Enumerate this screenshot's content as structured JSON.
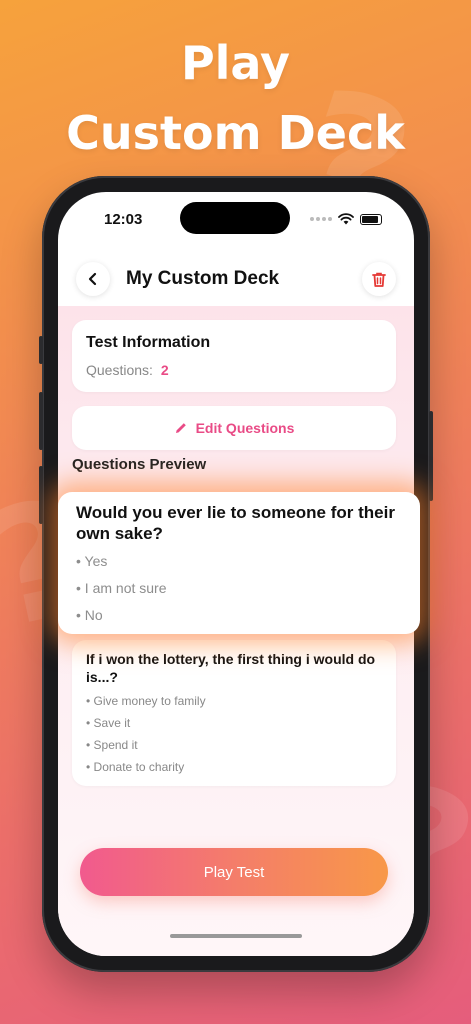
{
  "headline": {
    "line1": "Play",
    "line2": "Custom Deck"
  },
  "status": {
    "time": "12:03"
  },
  "nav": {
    "title": "My Custom Deck"
  },
  "test_info": {
    "title": "Test Information",
    "questions_label": "Questions:",
    "questions_count": "2"
  },
  "edit_button": {
    "label": "Edit Questions"
  },
  "preview": {
    "label": "Questions Preview",
    "questions": [
      {
        "text": "Would you ever lie to someone for their own sake?",
        "options": [
          "• Yes",
          "• I am not sure",
          "• No"
        ]
      },
      {
        "text": "If i won the lottery, the first thing i would do is...?",
        "options": [
          "• Give money to family",
          "• Save it",
          "• Spend it",
          "• Donate to charity"
        ]
      }
    ]
  },
  "play_button": {
    "label": "Play Test"
  },
  "colors": {
    "accent_pink": "#e94b86",
    "accent_orange": "#f89848",
    "delete_red": "#e53935"
  }
}
